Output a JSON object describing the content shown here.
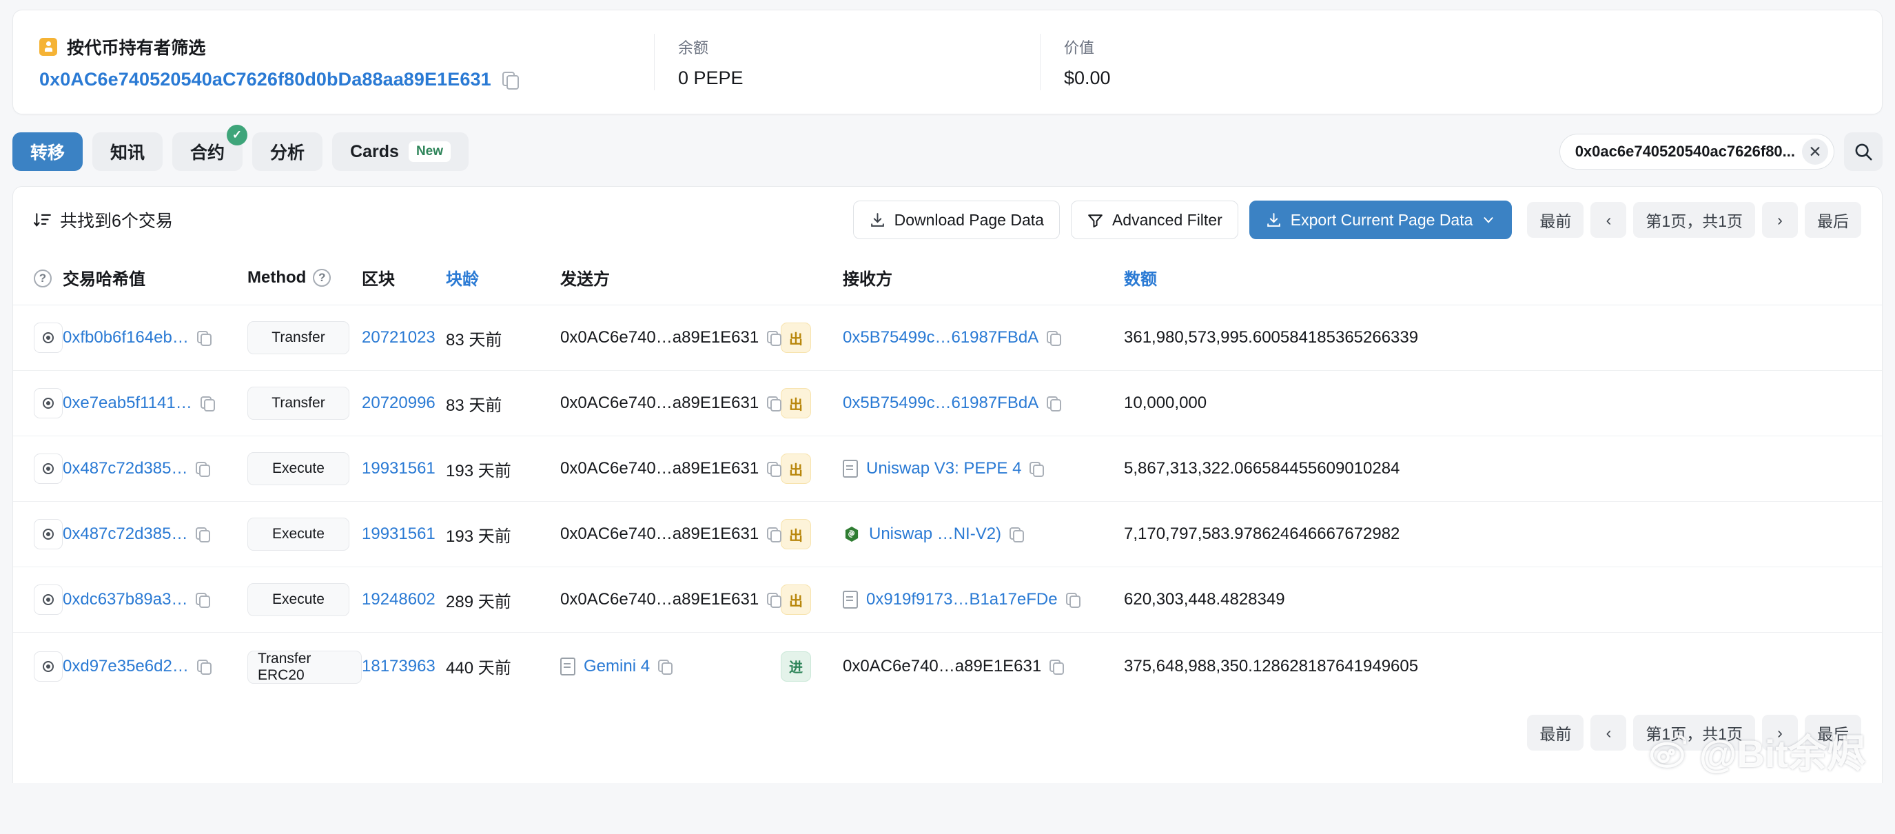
{
  "header": {
    "holder_filter_label": "按代币持有者筛选",
    "address": "0x0AC6e740520540aC7626f80d0bDa88aa89E1E631",
    "balance_label": "余额",
    "balance_value": "0 PEPE",
    "value_label": "价值",
    "value_value": "$0.00"
  },
  "tabs": [
    {
      "label": "转移",
      "active": true,
      "badge": null
    },
    {
      "label": "知讯",
      "active": false,
      "badge": null
    },
    {
      "label": "合约",
      "active": false,
      "badge": "check"
    },
    {
      "label": "分析",
      "active": false,
      "badge": null
    },
    {
      "label": "Cards",
      "active": false,
      "badge": "New"
    }
  ],
  "search": {
    "value": "0x0ac6e740520540ac7626f80...",
    "clear_label": "✕",
    "search_icon": "search-icon"
  },
  "toolbar": {
    "found_text": "共找到6个交易",
    "sort_icon": "sort-descending-icon",
    "download_page_data": "Download Page Data",
    "advanced_filter": "Advanced Filter",
    "export_current_page_data": "Export Current Page Data"
  },
  "pagination": {
    "first": "最前",
    "prev": "‹",
    "info": "第1页，共1页",
    "next": "›",
    "last": "最后"
  },
  "table": {
    "headers": {
      "eye": "?",
      "hash": "交易哈希值",
      "method": "Method",
      "block": "区块",
      "age": "块龄",
      "from": "发送方",
      "to": "接收方",
      "amount": "数额"
    },
    "rows": [
      {
        "hash": "0xfb0b6f164eb…",
        "method": "Transfer",
        "block": "20721023",
        "age": "83 天前",
        "from": "0x0AC6e740…a89E1E631",
        "from_icon": null,
        "direction": "出",
        "direction_type": "out",
        "to": "0x5B75499c…61987FBdA",
        "to_icon": null,
        "to_link": true,
        "amount": "361,980,573,995.600584185365266339"
      },
      {
        "hash": "0xe7eab5f1141…",
        "method": "Transfer",
        "block": "20720996",
        "age": "83 天前",
        "from": "0x0AC6e740…a89E1E631",
        "from_icon": null,
        "direction": "出",
        "direction_type": "out",
        "to": "0x5B75499c…61987FBdA",
        "to_icon": null,
        "to_link": true,
        "amount": "10,000,000"
      },
      {
        "hash": "0x487c72d385…",
        "method": "Execute",
        "block": "19931561",
        "age": "193 天前",
        "from": "0x0AC6e740…a89E1E631",
        "from_icon": null,
        "direction": "出",
        "direction_type": "out",
        "to": "Uniswap V3: PEPE 4",
        "to_icon": "contract-doc-icon",
        "to_link": true,
        "amount": "5,867,313,322.066584455609010284"
      },
      {
        "hash": "0x487c72d385…",
        "method": "Execute",
        "block": "19931561",
        "age": "193 天前",
        "from": "0x0AC6e740…a89E1E631",
        "from_icon": null,
        "direction": "出",
        "direction_type": "out",
        "to": "Uniswap …NI-V2)",
        "to_icon": "uniswap-logo-icon",
        "to_link": true,
        "amount": "7,170,797,583.978624646667672982"
      },
      {
        "hash": "0xdc637b89a3…",
        "method": "Execute",
        "block": "19248602",
        "age": "289 天前",
        "from": "0x0AC6e740…a89E1E631",
        "from_icon": null,
        "direction": "出",
        "direction_type": "out",
        "to": "0x919f9173…B1a17eFDe",
        "to_icon": "contract-doc-icon",
        "to_link": true,
        "amount": "620,303,448.4828349"
      },
      {
        "hash": "0xd97e35e6d2…",
        "method": "Transfer ERC20",
        "block": "18173963",
        "age": "440 天前",
        "from": "Gemini 4",
        "from_icon": "contract-doc-icon",
        "direction": "进",
        "direction_type": "in",
        "to": "0x0AC6e740…a89E1E631",
        "to_icon": null,
        "to_link": false,
        "amount": "375,648,988,350.128628187641949605"
      }
    ]
  },
  "watermark": {
    "text": "@Bit余烬",
    "icon": "weibo-logo-icon"
  },
  "colors": {
    "accent": "#3b82c4",
    "link": "#2a7ad4",
    "out_badge": "#b8860b",
    "in_badge": "#2f855a",
    "holder_icon": "#f5b335",
    "check_badge": "#3ea57a"
  }
}
